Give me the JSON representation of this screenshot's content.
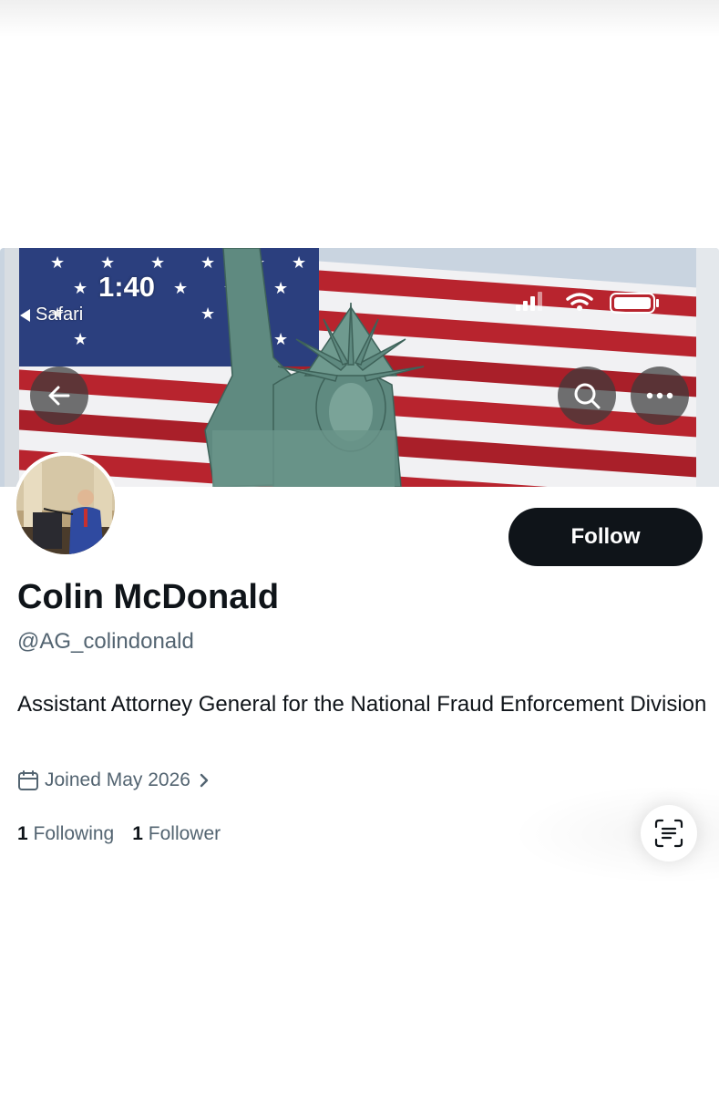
{
  "status_bar": {
    "time": "1:40",
    "back_app_label": "Safari"
  },
  "icons": {
    "back": "arrow-left-icon",
    "search": "search-icon",
    "more": "more-horizontal-icon",
    "calendar": "calendar-icon",
    "chevron": "chevron-right-icon",
    "scan": "text-scan-icon"
  },
  "profile": {
    "display_name": "Colin McDonald",
    "handle": "@AG_colindonald",
    "bio": "Assistant Attorney General for the National Fraud Enforcement Division",
    "joined": "Joined May 2026",
    "follow_label": "Follow",
    "following_count": "1",
    "following_label": "Following",
    "followers_count": "1",
    "followers_label": "Follower"
  },
  "colors": {
    "follow_button_bg": "#0f1419",
    "secondary_text": "#536471",
    "flag_red": "#b8242e",
    "flag_blue": "#2b3f7e",
    "statue_green": "#5f8a80"
  }
}
